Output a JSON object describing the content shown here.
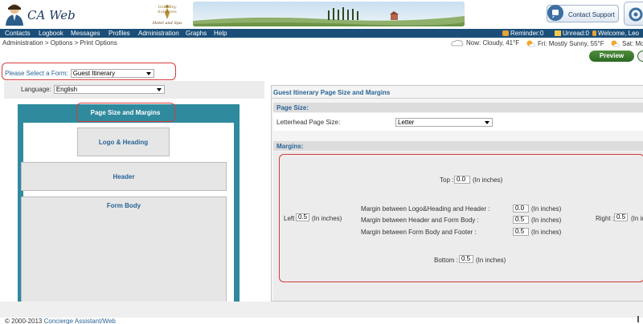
{
  "header": {
    "app_name": "CA Web",
    "partner_logo_line1": "Gold Key Solutions",
    "partner_logo_line2": "Hotel and Spa",
    "support_label": "Contact Support",
    "icons": {
      "avatar": "concierge-avatar-icon",
      "support": "support-headset-icon",
      "settings": "settings-icon"
    }
  },
  "menu": {
    "items": [
      "Contacts",
      "Logbook",
      "Messages",
      "Profiles",
      "Administration",
      "Graphs",
      "Help"
    ],
    "reminder": "Reminder:0",
    "unread": "Unread:0",
    "welcome": "Welcome, Leo"
  },
  "breadcrumb": "Administration > Options > Print Options",
  "weather": {
    "now": "Now: Cloudy, 41°F",
    "fri": "Fri: Mostly Sunny, 55°F",
    "sat": "Sat: Mo"
  },
  "toolbar": {
    "preview_label": "Preview"
  },
  "form_select": {
    "label": "Please Select a Form:",
    "value": "Guest Itinerary"
  },
  "language": {
    "label": "Language:",
    "value": "English"
  },
  "layout_preview": {
    "active_section": "Page Size and Margins",
    "logo_heading": "Logo & Heading",
    "header": "Header",
    "form_body": "Form Body"
  },
  "settings_panel": {
    "title": "Guest Itinerary Page Size and Margins",
    "page_size_section": "Page Size:",
    "letterhead_label": "Letterhead Page Size:",
    "letterhead_value": "Letter",
    "margins_section": "Margins:",
    "top_label": "Top :",
    "top_value": "0.0",
    "left_label": "Left :",
    "left_value": "0.5",
    "right_label": "Right :",
    "right_value": "0.5",
    "right_unit": "(In in",
    "bottom_label": "Bottom :",
    "bottom_value": "0.5",
    "unit": "(In inches)",
    "logo_header_label": "Margin between Logo&Heading and Header :",
    "logo_header_value": "0.0",
    "header_body_label": "Margin between Header and Form Body :",
    "header_body_value": "0.5",
    "body_footer_label": "Margin between Form Body and Footer :",
    "body_footer_value": "0.5"
  },
  "footer": {
    "copyright": "© 2000-2013",
    "link": "Concierge Assistant/Web"
  },
  "colors": {
    "menu_bg": "#1b4f79",
    "accent_teal": "#2f8a9e",
    "highlight": "#d63b3b",
    "preview_green": "#2b6a23",
    "label_blue": "#2a6496"
  }
}
